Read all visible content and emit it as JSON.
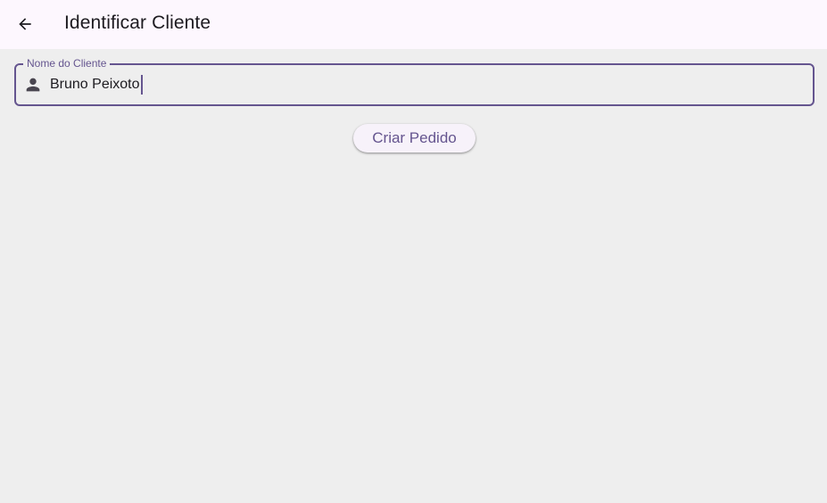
{
  "app_bar": {
    "title": "Identificar Cliente",
    "back_icon": "arrow-back-icon",
    "background": "#fdf7fe"
  },
  "form": {
    "customer_name": {
      "label": "Nome do Cliente",
      "value": "Bruno Peixoto",
      "icon": "person-icon",
      "accent": "#65558f"
    },
    "submit_label": "Criar Pedido"
  }
}
